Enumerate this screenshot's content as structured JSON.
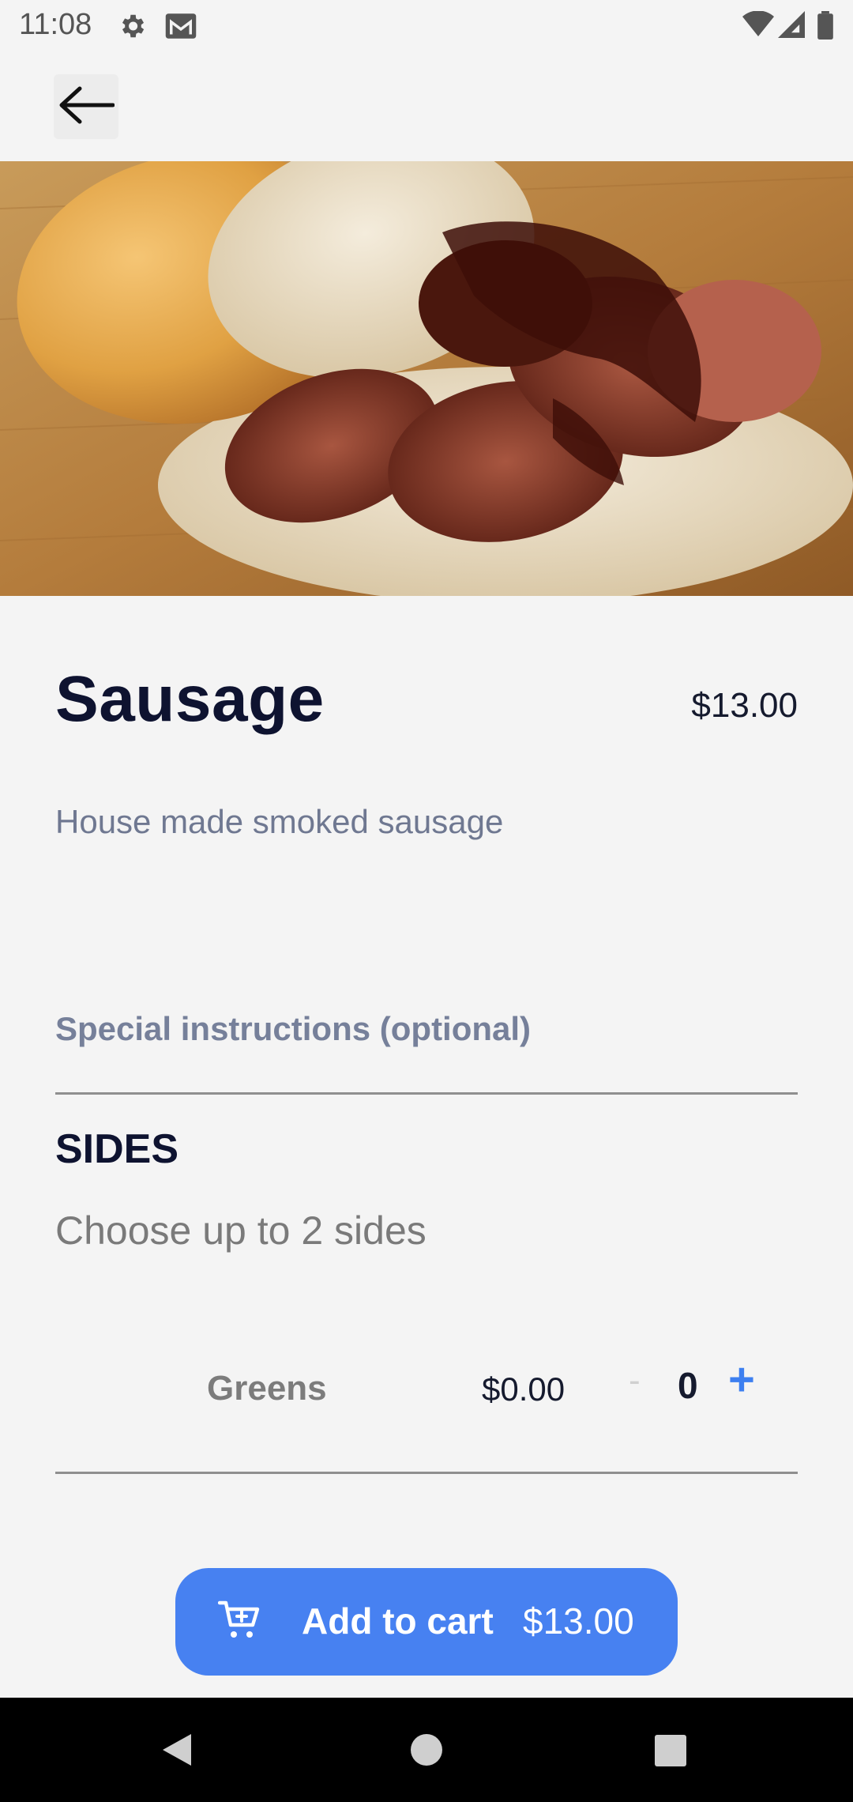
{
  "status_bar": {
    "time": "11:08",
    "icons": [
      "settings-icon",
      "gmail-icon",
      "wifi-icon",
      "signal-icon",
      "battery-icon"
    ]
  },
  "toolbar": {
    "back_icon": "arrow-left-icon"
  },
  "item": {
    "name": "Sausage",
    "price": "$13.00",
    "description": "House made smoked sausage"
  },
  "special_instructions": {
    "label": "Special instructions (optional)"
  },
  "sides": {
    "heading": "SIDES",
    "subtitle": "Choose up to 2 sides",
    "options": [
      {
        "name": "Greens",
        "price": "$0.00",
        "minus": "-",
        "quantity": "0",
        "plus": "+"
      }
    ]
  },
  "cart_button": {
    "icon": "cart-plus-icon",
    "label": "Add to cart",
    "total": "$13.00"
  },
  "colors": {
    "accent": "#4781f1",
    "title": "#0e1330",
    "muted": "#76809a",
    "background": "#f4f4f4"
  },
  "nav_bar": {
    "icons": [
      "back-triangle-icon",
      "home-circle-icon",
      "recents-square-icon"
    ]
  }
}
